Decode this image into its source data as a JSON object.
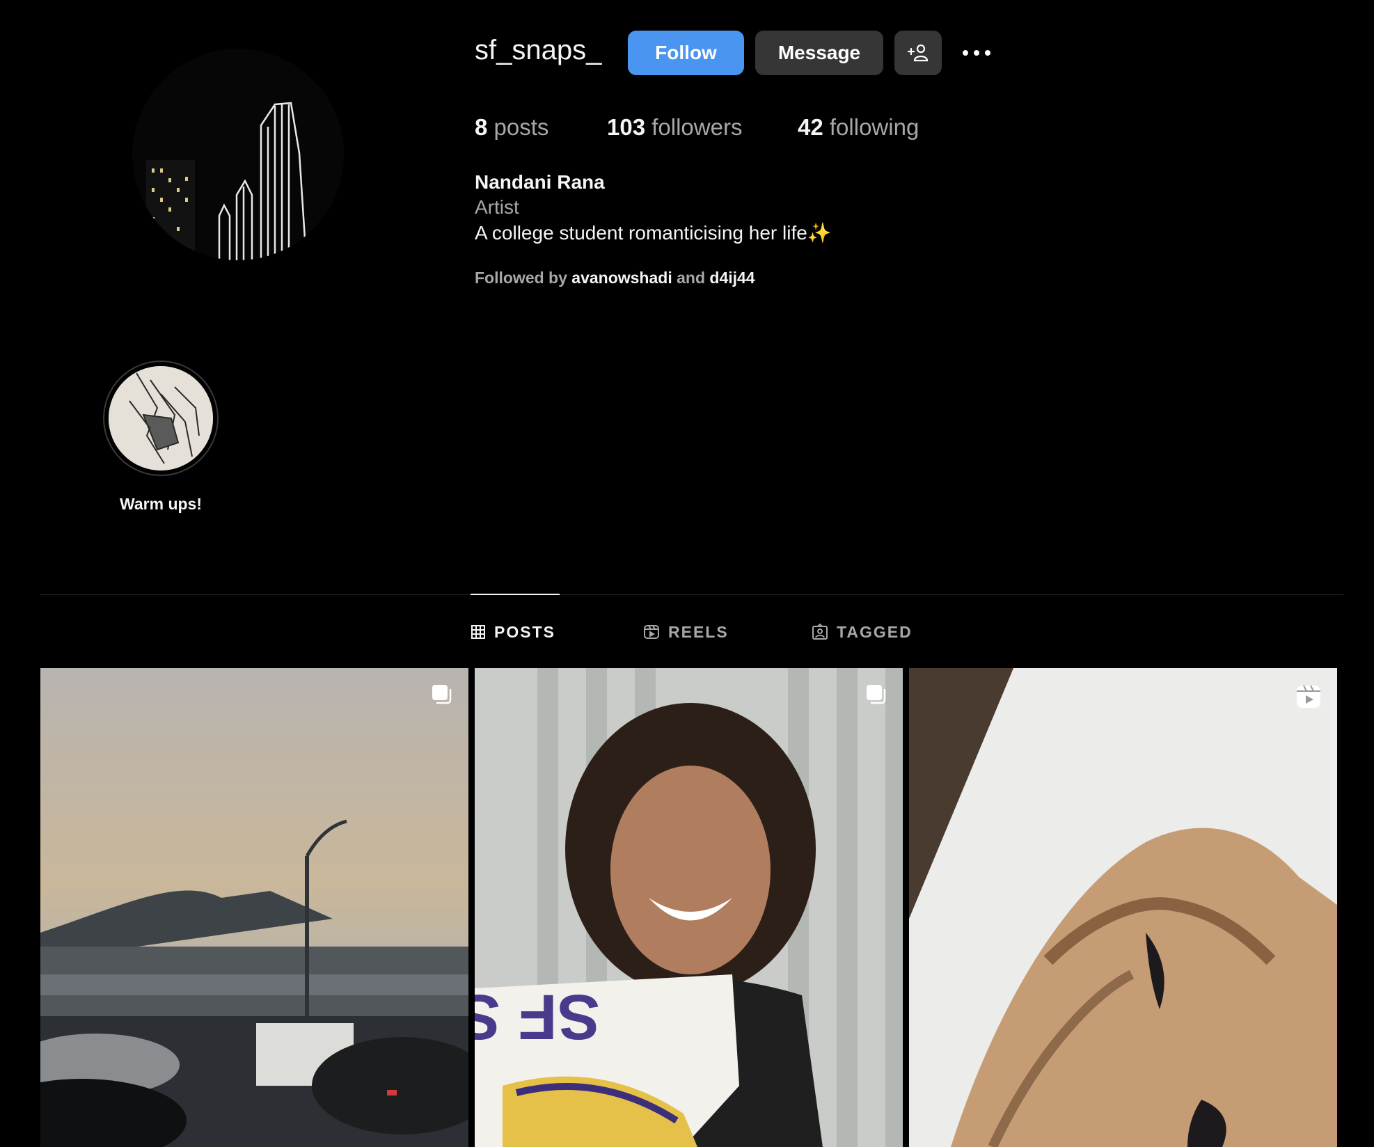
{
  "profile": {
    "username": "sf_snaps_",
    "follow_label": "Follow",
    "message_label": "Message",
    "full_name": "Nandani Rana",
    "category": "Artist",
    "bio": "A college student romanticising her life✨",
    "followed_by_prefix": "Followed by",
    "followed_by_user1": "avanowshadi",
    "followed_by_and": "and",
    "followed_by_user2": "d4ij44"
  },
  "stats": {
    "posts_count": "8",
    "posts_label": "posts",
    "followers_count": "103",
    "followers_label": "followers",
    "following_count": "42",
    "following_label": "following"
  },
  "highlights": [
    {
      "label": "Warm ups!"
    }
  ],
  "tabs": [
    {
      "label": "POSTS",
      "icon": "grid-icon",
      "active": true
    },
    {
      "label": "REELS",
      "icon": "reels-icon",
      "active": false
    },
    {
      "label": "TAGGED",
      "icon": "tagged-icon",
      "active": false
    }
  ],
  "posts": [
    {
      "type": "carousel",
      "icon": "carousel-icon"
    },
    {
      "type": "carousel",
      "icon": "carousel-icon",
      "sign_text": "SF STATE"
    },
    {
      "type": "reel",
      "icon": "reel-icon"
    }
  ],
  "colors": {
    "background": "#000000",
    "follow_button": "#4a95f0",
    "secondary_button": "#363636",
    "muted_text": "#a8a8a8"
  }
}
